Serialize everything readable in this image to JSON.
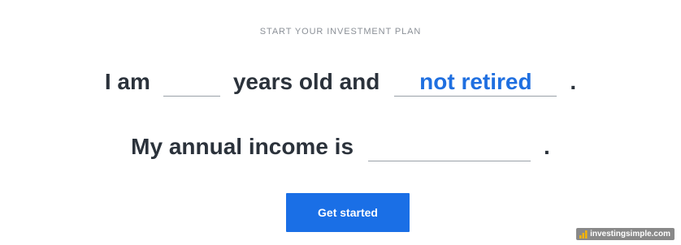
{
  "header": {
    "eyebrow": "START YOUR INVESTMENT PLAN"
  },
  "sentence1": {
    "prefix": "I am",
    "age_value": "",
    "middle": "years old and",
    "retirement_value": "not retired",
    "suffix": "."
  },
  "sentence2": {
    "prefix": "My annual income is",
    "income_value": "",
    "suffix": "."
  },
  "cta": {
    "label": "Get started"
  },
  "watermark": {
    "text": "investingsimple.com",
    "icon": "bar-chart-icon"
  },
  "colors": {
    "accent": "#1a6fe6",
    "text": "#2b323b",
    "muted": "#8b9097",
    "selected_value": "#1f6fe0"
  }
}
